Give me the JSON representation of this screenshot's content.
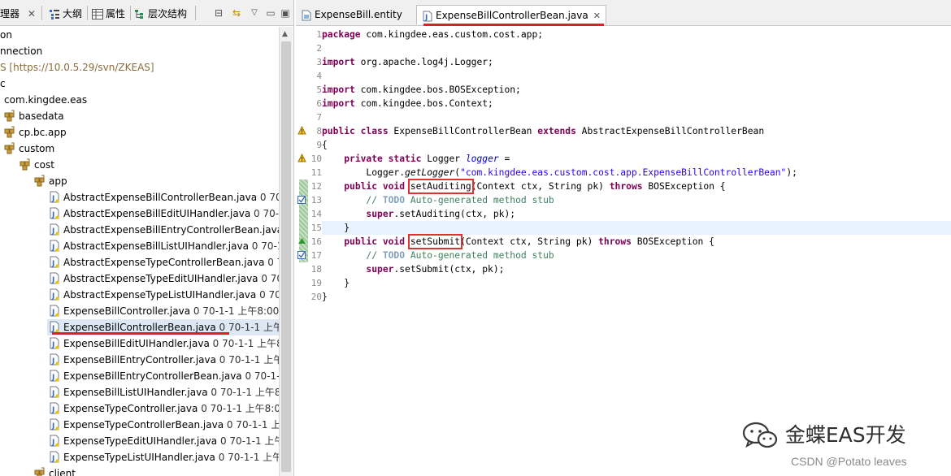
{
  "left_panel": {
    "tabs": [
      {
        "label": "理器",
        "icon": "package-explorer-icon"
      },
      {
        "label": "大纲",
        "icon": "outline-icon"
      },
      {
        "label": "属性",
        "icon": "properties-icon"
      },
      {
        "label": "层次结构",
        "icon": "hierarchy-icon"
      }
    ],
    "toolbar": {
      "collapse": "⊟",
      "link": "⇆",
      "menu": "▽",
      "minimize": "▭",
      "maximize": "▣"
    },
    "tree": [
      {
        "name": "on",
        "meta": "",
        "icon": "none",
        "indent": 0
      },
      {
        "name": "nnection",
        "meta": "",
        "icon": "none",
        "indent": 0
      },
      {
        "name": "S [https://10.0.5.29/svn/ZKEAS]",
        "meta": "",
        "icon": "none",
        "indent": 0,
        "svn": true
      },
      {
        "name": "c",
        "meta": "",
        "icon": "none",
        "indent": 0
      },
      {
        "name": "com.kingdee.eas",
        "meta": "",
        "icon": "none",
        "indent": 1
      },
      {
        "name": "basedata",
        "meta": "",
        "icon": "package-icon",
        "indent": 2
      },
      {
        "name": "cp.bc.app",
        "meta": "",
        "icon": "package-icon",
        "indent": 2
      },
      {
        "name": "custom",
        "meta": "",
        "icon": "package-icon",
        "indent": 2
      },
      {
        "name": "cost",
        "meta": "",
        "icon": "package-icon",
        "indent": 3
      },
      {
        "name": "app",
        "meta": "",
        "icon": "package-icon",
        "indent": 4
      },
      {
        "name": "AbstractExpenseBillControllerBean.java",
        "meta": " 0  70-",
        "icon": "java-file-icon",
        "indent": 5
      },
      {
        "name": "AbstractExpenseBillEditUIHandler.java",
        "meta": " 0  70-1",
        "icon": "java-file-icon",
        "indent": 5
      },
      {
        "name": "AbstractExpenseBillEntryControllerBean.java",
        "meta": "",
        "icon": "java-file-icon",
        "indent": 5
      },
      {
        "name": "AbstractExpenseBillListUIHandler.java",
        "meta": " 0  70-1",
        "icon": "java-file-icon",
        "indent": 5
      },
      {
        "name": "AbstractExpenseTypeControllerBean.java",
        "meta": " 0  7",
        "icon": "java-file-icon",
        "indent": 5
      },
      {
        "name": "AbstractExpenseTypeEditUIHandler.java",
        "meta": " 0  70",
        "icon": "java-file-icon",
        "indent": 5
      },
      {
        "name": "AbstractExpenseTypeListUIHandler.java",
        "meta": " 0  70",
        "icon": "java-file-icon",
        "indent": 5
      },
      {
        "name": "ExpenseBillController.java",
        "meta": " 0  70-1-1 上午8:00",
        "icon": "java-file-icon",
        "indent": 5
      },
      {
        "name": "ExpenseBillControllerBean.java",
        "meta": " 0  70-1-1 上午",
        "icon": "java-file-icon",
        "indent": 5,
        "selected": true
      },
      {
        "name": "ExpenseBillEditUIHandler.java",
        "meta": " 0  70-1-1 上午8",
        "icon": "java-file-icon",
        "indent": 5
      },
      {
        "name": "ExpenseBillEntryController.java",
        "meta": " 0  70-1-1 上午",
        "icon": "java-file-icon",
        "indent": 5
      },
      {
        "name": "ExpenseBillEntryControllerBean.java",
        "meta": " 0  70-1-1",
        "icon": "java-file-icon",
        "indent": 5
      },
      {
        "name": "ExpenseBillListUIHandler.java",
        "meta": " 0  70-1-1 上午8",
        "icon": "java-file-icon",
        "indent": 5
      },
      {
        "name": "ExpenseTypeController.java",
        "meta": " 0  70-1-1 上午8:0",
        "icon": "java-file-icon",
        "indent": 5
      },
      {
        "name": "ExpenseTypeControllerBean.java",
        "meta": " 0  70-1-1 上",
        "icon": "java-file-icon",
        "indent": 5
      },
      {
        "name": "ExpenseTypeEditUIHandler.java",
        "meta": " 0  70-1-1 上午",
        "icon": "java-file-icon",
        "indent": 5
      },
      {
        "name": "ExpenseTypeListUIHandler.java",
        "meta": " 0  70-1-1 上午",
        "icon": "java-file-icon",
        "indent": 5
      },
      {
        "name": "client",
        "meta": "",
        "icon": "package-icon",
        "indent": 4
      }
    ]
  },
  "editor": {
    "tabs": [
      {
        "label": "ExpenseBill.entity",
        "icon": "entity-file-icon",
        "active": false
      },
      {
        "label": "ExpenseBillControllerBean.java",
        "icon": "java-file-icon",
        "active": true,
        "close": "✕"
      }
    ],
    "lines": [
      {
        "n": "1",
        "segs": [
          [
            "kw",
            "package"
          ],
          [
            "",
            "com.kingdee.eas.custom.cost.app;"
          ]
        ]
      },
      {
        "n": "2",
        "segs": []
      },
      {
        "n": "3",
        "segs": [
          [
            "kw",
            "import"
          ],
          [
            "",
            "org.apache.log4j.Logger;"
          ]
        ]
      },
      {
        "n": "4",
        "segs": []
      },
      {
        "n": "5",
        "segs": [
          [
            "kw",
            "import"
          ],
          [
            "",
            "com.kingdee.bos.BOSException;"
          ]
        ]
      },
      {
        "n": "6",
        "segs": [
          [
            "kw",
            "import"
          ],
          [
            "",
            "com.kingdee.bos.Context;"
          ]
        ]
      },
      {
        "n": "7",
        "segs": []
      },
      {
        "n": "8",
        "segs": [
          [
            "kw",
            "public class"
          ],
          [
            "",
            " ExpenseBillControllerBean "
          ],
          [
            "kw",
            "extends"
          ],
          [
            "",
            " AbstractExpenseBillControllerBean"
          ]
        ]
      },
      {
        "n": "9",
        "segs": [
          [
            "",
            "{"
          ]
        ]
      },
      {
        "n": "10",
        "segs": [
          [
            "",
            "    "
          ],
          [
            "kw",
            "private static"
          ],
          [
            "",
            " Logger "
          ],
          [
            "fld",
            "logger"
          ],
          [
            "",
            " ="
          ]
        ]
      },
      {
        "n": "11",
        "segs": [
          [
            "",
            "        Logger."
          ],
          [
            "smeth",
            "getLogger"
          ],
          [
            "",
            "("
          ],
          [
            "str",
            "\"com.kingdee.eas.custom.cost.app.ExpenseBillControllerBean\""
          ],
          [
            "",
            ");"
          ]
        ]
      },
      {
        "n": "12",
        "segs": [
          [
            "",
            "    "
          ],
          [
            "kw",
            "public void"
          ],
          [
            "",
            ""
          ],
          [
            "hl",
            " setAuditing"
          ],
          [
            "",
            "(Context ctx, String pk) "
          ],
          [
            "kw",
            "throws"
          ],
          [
            "",
            " BOSException {"
          ]
        ]
      },
      {
        "n": "13",
        "segs": [
          [
            "",
            "        "
          ],
          [
            "cmt",
            "// "
          ],
          [
            "todo",
            "TODO"
          ],
          [
            "cmt",
            " Auto-generated method stub"
          ]
        ]
      },
      {
        "n": "14",
        "segs": [
          [
            "",
            "        "
          ],
          [
            "kw",
            "super"
          ],
          [
            "",
            ".setAuditing(ctx, pk);"
          ]
        ]
      },
      {
        "n": "15",
        "segs": [
          [
            "",
            "    }"
          ]
        ],
        "cur": true
      },
      {
        "n": "16",
        "segs": [
          [
            "",
            "    "
          ],
          [
            "kw",
            "public void"
          ],
          [
            "",
            ""
          ],
          [
            "hl",
            " setSubmit"
          ],
          [
            "",
            "(Context ctx, String pk) "
          ],
          [
            "kw",
            "throws"
          ],
          [
            "",
            " BOSException {"
          ]
        ]
      },
      {
        "n": "17",
        "segs": [
          [
            "",
            "        "
          ],
          [
            "cmt",
            "// "
          ],
          [
            "todo",
            "TODO"
          ],
          [
            "cmt",
            " Auto-generated method stub"
          ]
        ]
      },
      {
        "n": "18",
        "segs": [
          [
            "",
            "        "
          ],
          [
            "kw",
            "super"
          ],
          [
            "",
            ".setSubmit(ctx, pk);"
          ]
        ]
      },
      {
        "n": "19",
        "segs": [
          [
            "",
            "    }"
          ]
        ]
      },
      {
        "n": "20",
        "segs": [
          [
            "",
            "}"
          ]
        ]
      }
    ]
  },
  "watermark": {
    "text": "金蝶EAS开发",
    "icon": "wechat-logo-icon"
  },
  "credit": "CSDN @Potato leaves",
  "colors": {
    "highlight": "#e03030",
    "keyword": "#7f0055",
    "string": "#2a00ff",
    "comment": "#3f7f5f"
  }
}
